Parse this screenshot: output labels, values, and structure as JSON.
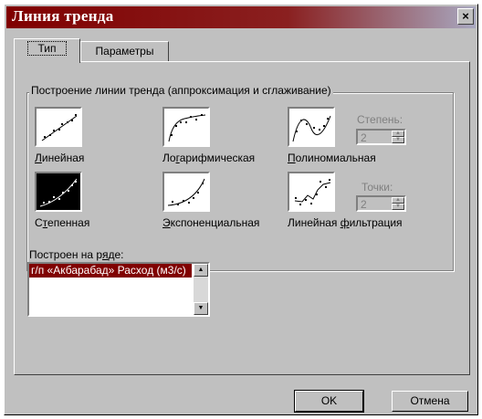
{
  "window": {
    "title": "Линия тренда",
    "close_label": "×"
  },
  "tabs": [
    {
      "label": "Тип",
      "active": true
    },
    {
      "label": "Параметры",
      "active": false
    }
  ],
  "group": {
    "title": "Построение линии тренда (аппроксимация и сглаживание)",
    "types": [
      {
        "pre": "",
        "u": "Л",
        "post": "инейная",
        "icon": "linear-trend-icon"
      },
      {
        "pre": "Ло",
        "u": "г",
        "post": "арифмическая",
        "icon": "logarithmic-trend-icon"
      },
      {
        "pre": "",
        "u": "П",
        "post": "олиномиальная",
        "icon": "polynomial-trend-icon"
      },
      {
        "pre": "С",
        "u": "т",
        "post": "епенная",
        "icon": "power-trend-icon",
        "selected": true
      },
      {
        "pre": "",
        "u": "Э",
        "post": "кспоненциальная",
        "icon": "exponential-trend-icon"
      },
      {
        "pre": "Линейная ",
        "u": "ф",
        "post": "ильтрация",
        "icon": "moving-average-trend-icon"
      }
    ],
    "degree": {
      "label": "Степень:",
      "value": "2"
    },
    "points": {
      "label": "Точки:",
      "value": "2"
    }
  },
  "series": {
    "label_pre": "Построен на р",
    "label_u": "я",
    "label_post": "де:",
    "items": [
      "г/п «Акбарабад» Расход (м3/с)"
    ]
  },
  "buttons": {
    "ok": "OK",
    "cancel": "Отмена"
  },
  "colors": {
    "titlebar": "#800000",
    "face": "#c0c0c0",
    "selection": "#800000"
  }
}
